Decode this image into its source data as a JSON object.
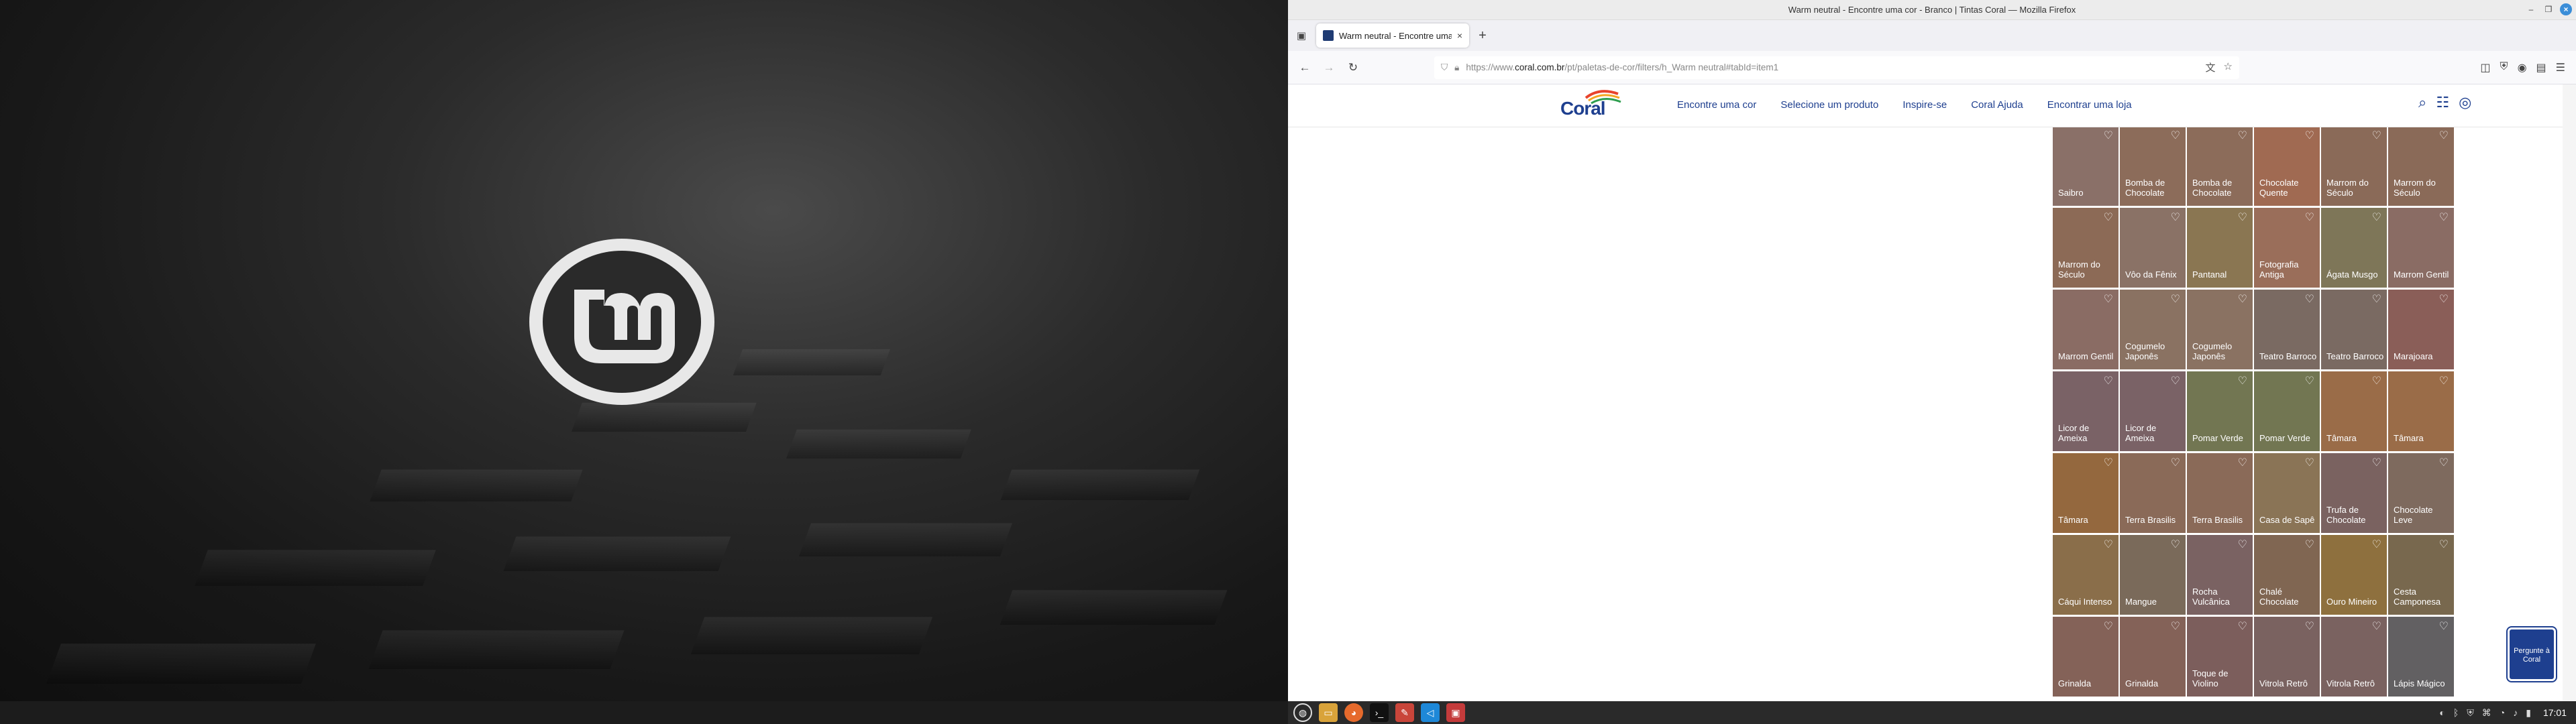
{
  "window": {
    "title": "Warm neutral - Encontre uma cor - Branco | Tintas Coral — Mozilla Firefox"
  },
  "tab": {
    "title": "Warm neutral - Encontre uma cor"
  },
  "urlbar": {
    "prefix": "https://www.",
    "host": "coral.com.br",
    "path": "/pt/paletas-de-cor/filters/h_Warm neutral#tabId=item1"
  },
  "site": {
    "logo": "Coral",
    "nav": [
      "Encontre uma cor",
      "Selecione um produto",
      "Inspire-se",
      "Coral Ajuda",
      "Encontrar uma loja"
    ],
    "ask_button": "Pergunte à Coral"
  },
  "swatches": [
    [
      {
        "name": "Saibro",
        "color": "#8a7068"
      },
      {
        "name": "Bomba de Chocolate",
        "color": "#8c6c5a"
      },
      {
        "name": "Bomba de Chocolate",
        "color": "#8c6c5a"
      },
      {
        "name": "Chocolate Quente",
        "color": "#a06a52"
      },
      {
        "name": "Marrom do Século",
        "color": "#8a6a58"
      },
      {
        "name": "Marrom do Século",
        "color": "#8a6a58"
      }
    ],
    [
      {
        "name": "Marrom do Século",
        "color": "#8c6a56"
      },
      {
        "name": "Vôo da Fênix",
        "color": "#8a7266"
      },
      {
        "name": "Pantanal",
        "color": "#8a7652"
      },
      {
        "name": "Fotografia Antiga",
        "color": "#9a6e5a"
      },
      {
        "name": "Ágata Musgo",
        "color": "#7e7658"
      },
      {
        "name": "Marrom Gentil",
        "color": "#8a6c64"
      }
    ],
    [
      {
        "name": "Marrom Gentil",
        "color": "#8a6c64"
      },
      {
        "name": "Cogumelo Japonês",
        "color": "#8a7262"
      },
      {
        "name": "Cogumelo Japonês",
        "color": "#8a7262"
      },
      {
        "name": "Teatro Barroco",
        "color": "#7a6a62"
      },
      {
        "name": "Teatro Barroco",
        "color": "#7a6a62"
      },
      {
        "name": "Marajoara",
        "color": "#8a5e58"
      }
    ],
    [
      {
        "name": "Licor de Ameixa",
        "color": "#7a6266"
      },
      {
        "name": "Licor de Ameixa",
        "color": "#7a6266"
      },
      {
        "name": "Pomar Verde",
        "color": "#727652"
      },
      {
        "name": "Pomar Verde",
        "color": "#727652"
      },
      {
        "name": "Tâmara",
        "color": "#9a6c48"
      },
      {
        "name": "Tâmara",
        "color": "#9a6c48"
      }
    ],
    [
      {
        "name": "Tâmara",
        "color": "#94683e"
      },
      {
        "name": "Terra Brasilis",
        "color": "#8a6a58"
      },
      {
        "name": "Terra Brasilis",
        "color": "#8a6a58"
      },
      {
        "name": "Casa de Sapê",
        "color": "#8a7456"
      },
      {
        "name": "Trufa de Chocolate",
        "color": "#7a6260"
      },
      {
        "name": "Chocolate Leve",
        "color": "#7e6a5e"
      }
    ],
    [
      {
        "name": "Cáqui Intenso",
        "color": "#8a6e4a"
      },
      {
        "name": "Mangue",
        "color": "#7a6a5a"
      },
      {
        "name": "Rocha Vulcânica",
        "color": "#7a6262"
      },
      {
        "name": "Chalé Chocolate",
        "color": "#806652"
      },
      {
        "name": "Ouro Mineiro",
        "color": "#8e703e"
      },
      {
        "name": "Cesta Camponesa",
        "color": "#78684e"
      }
    ],
    [
      {
        "name": "Grinalda",
        "color": "#846258"
      },
      {
        "name": "Grinalda",
        "color": "#846258"
      },
      {
        "name": "Toque de Violino",
        "color": "#7c5e5c"
      },
      {
        "name": "Vitrola Retrô",
        "color": "#7a6260"
      },
      {
        "name": "Vitrola Retrô",
        "color": "#7a6260"
      },
      {
        "name": "Lápis Mágico",
        "color": "#626062"
      }
    ]
  ],
  "taskbar": {
    "clock": "17:01"
  }
}
